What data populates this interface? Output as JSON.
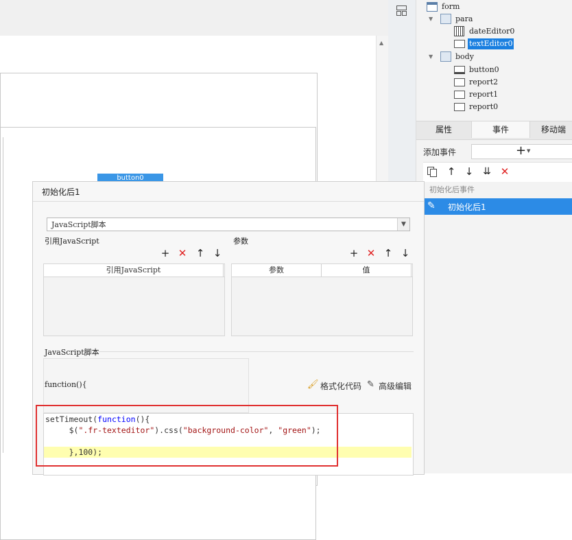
{
  "structure_tree": {
    "items": [
      {
        "label": "form",
        "icon": "form-icon",
        "level": 0
      },
      {
        "label": "para",
        "icon": "panel-icon",
        "level": 1
      },
      {
        "label": "dateEditor0",
        "icon": "calendar-icon",
        "level": 2
      },
      {
        "label": "textEditor0",
        "icon": "textbox-icon",
        "level": 2,
        "selected": true
      },
      {
        "label": "body",
        "icon": "panel-icon",
        "level": 1
      },
      {
        "label": "button0",
        "icon": "button-icon",
        "level": 2
      },
      {
        "label": "report2",
        "icon": "report-icon",
        "level": 2
      },
      {
        "label": "report1",
        "icon": "report-icon",
        "level": 2
      },
      {
        "label": "report0",
        "icon": "report-icon",
        "level": 2
      }
    ]
  },
  "panel_tabs": [
    "属性",
    "事件",
    "移动端"
  ],
  "active_tab": "事件",
  "add_event_label": "添加事件",
  "event_group_label": "初始化后事件",
  "event_item_label": "初始化后1",
  "canvas_button_label": "button0",
  "dialog": {
    "title": "初始化后1",
    "type_select_value": "JavaScript脚本",
    "ref_section_label": "引用JavaScript",
    "ref_column": "引用JavaScript",
    "param_section_label": "参数",
    "param_columns": [
      "参数",
      "值"
    ],
    "script_section_label": "JavaScript脚本",
    "function_header": "function(){",
    "format_code_label": "格式化代码",
    "advanced_edit_label": "高级编辑",
    "code_lines": [
      "setTimeout(function(){",
      "     $(\".fr-texteditor\").css(\"background-color\", \"green\");",
      "",
      "     },100);"
    ]
  },
  "colors": {
    "accent": "#1a7fe0",
    "delete": "#e02424",
    "highlight_box": "#e03030"
  }
}
